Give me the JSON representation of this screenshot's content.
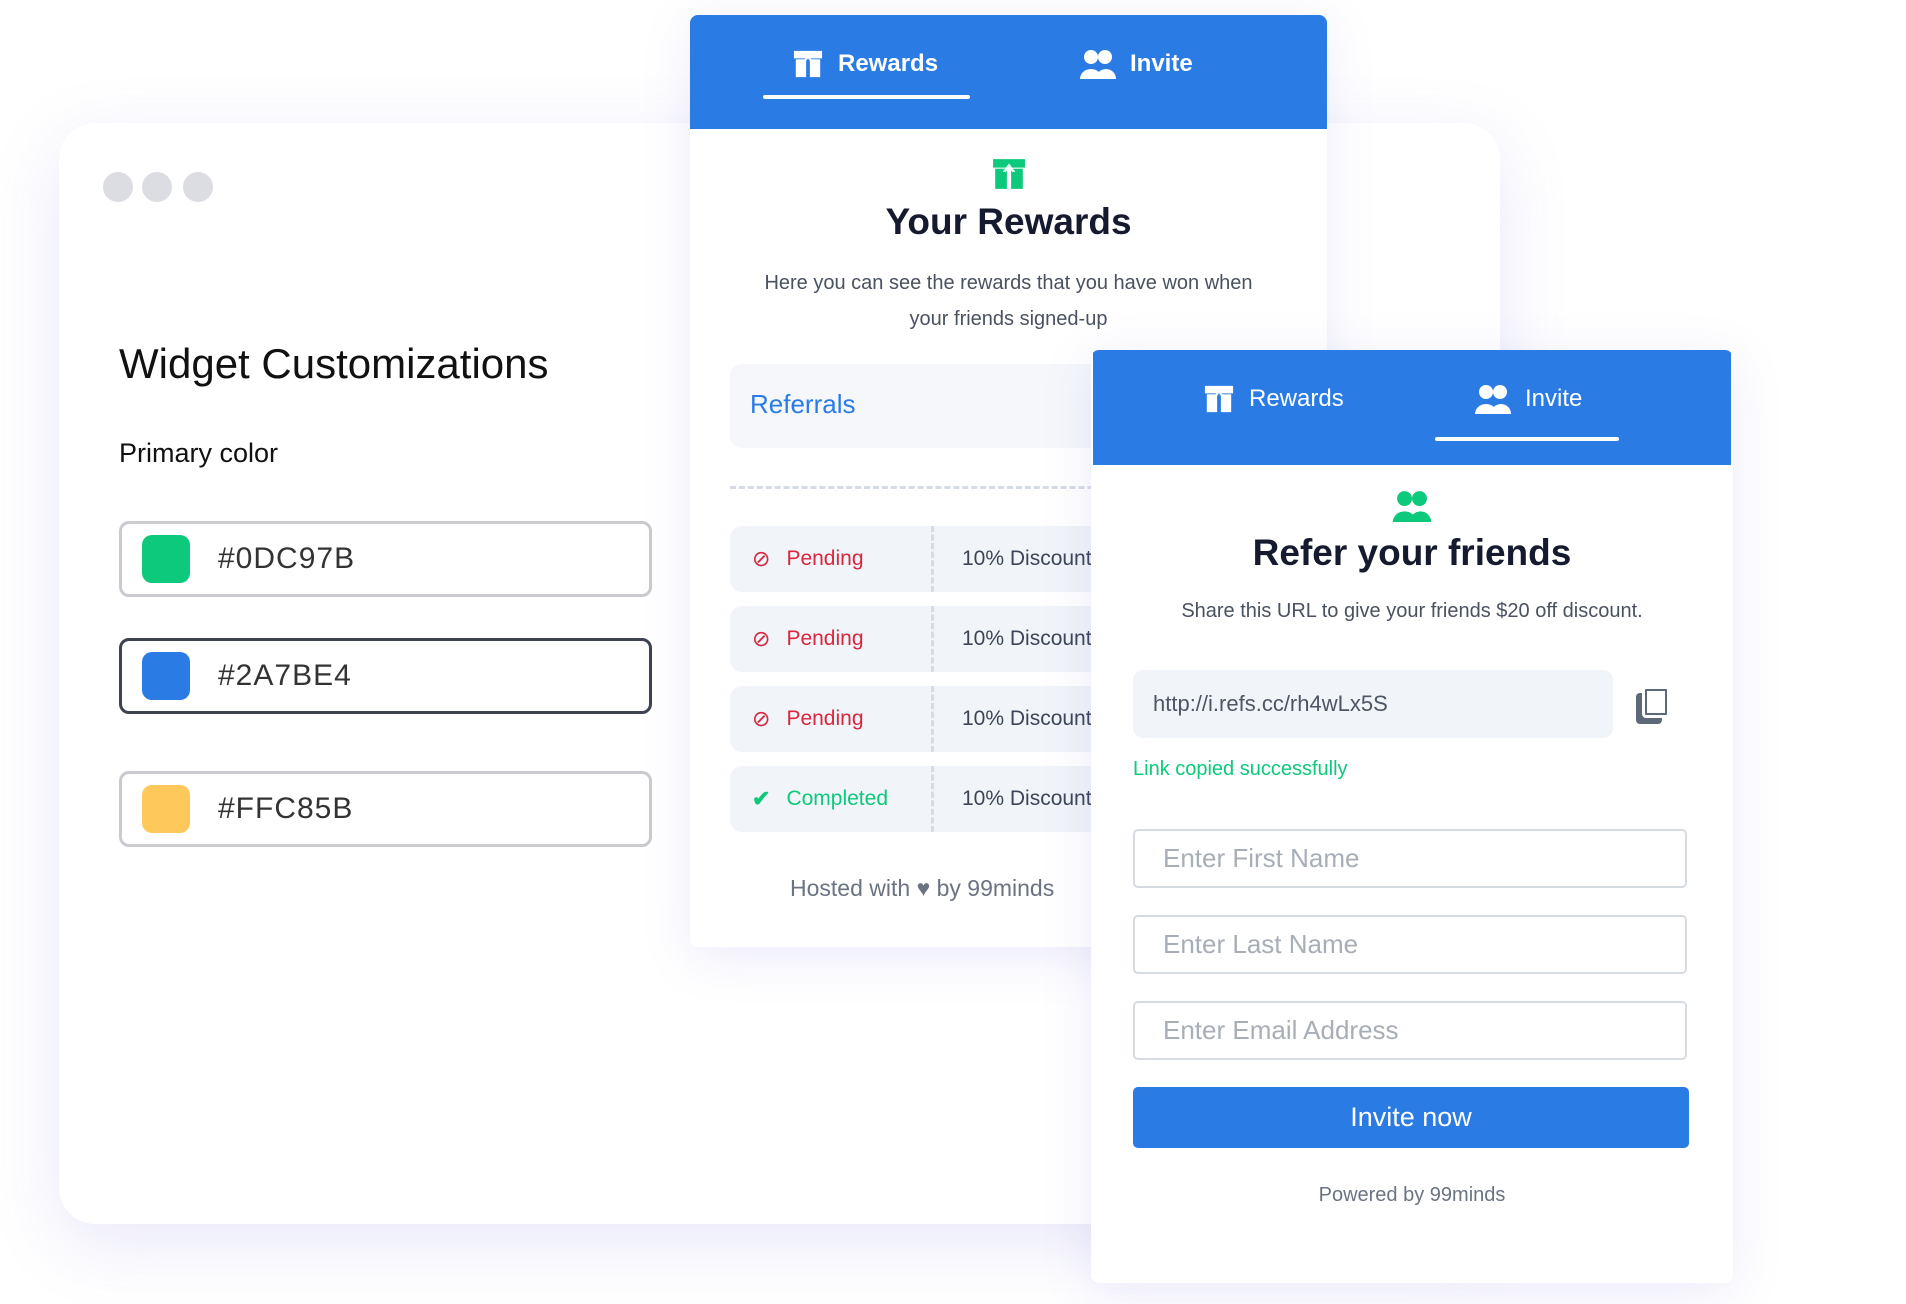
{
  "colors": {
    "primary": "#2A7BE4",
    "accent": "#0DC97B",
    "pending": "#D7263D"
  },
  "customizer": {
    "title": "Widget Customizations",
    "primary_label": "Primary color",
    "swatches": [
      {
        "hex": "#0DC97B",
        "label": "#0DC97B"
      },
      {
        "hex": "#2A7BE4",
        "label": "#2A7BE4",
        "selected": true
      },
      {
        "hex": "#FFC85B",
        "label": "#FFC85B"
      }
    ]
  },
  "rewards_widget": {
    "tabs": [
      {
        "label": "Rewards",
        "icon": "gift-icon",
        "active": true
      },
      {
        "label": "Invite",
        "icon": "users-icon"
      }
    ],
    "title": "Your Rewards",
    "desc_line1": "Here you can see the rewards that you have won when",
    "desc_line2": "your friends signed-up",
    "section": "Referrals",
    "rows": [
      {
        "status": "Pending",
        "reward": "10% Discount"
      },
      {
        "status": "Pending",
        "reward": "10% Discount"
      },
      {
        "status": "Pending",
        "reward": "10% Discount"
      },
      {
        "status": "Completed",
        "reward": "10% Discount"
      }
    ],
    "footer_pre": "Hosted with",
    "footer_post": "by 99minds"
  },
  "invite_widget": {
    "tabs": [
      {
        "label": "Rewards",
        "icon": "gift-icon"
      },
      {
        "label": "Invite",
        "icon": "users-icon",
        "active": true
      }
    ],
    "title": "Refer your friends",
    "desc": "Share this URL to give your friends $20 off discount.",
    "url": "http://i.refs.cc/rh4wLx5S",
    "copied": "Link copied successfully",
    "first_name_placeholder": "Enter First Name",
    "last_name_placeholder": "Enter Last Name",
    "email_placeholder": "Enter Email Address",
    "button": "Invite now",
    "footer": "Powered by 99minds"
  }
}
